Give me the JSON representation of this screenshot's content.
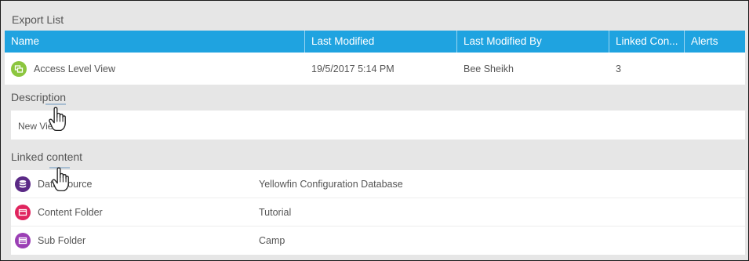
{
  "panel": {
    "title": "Export List"
  },
  "grid": {
    "columns": [
      {
        "label": "Name"
      },
      {
        "label": "Last Modified"
      },
      {
        "label": "Last Modified By"
      },
      {
        "label": "Linked Con..."
      },
      {
        "label": "Alerts"
      }
    ],
    "row": {
      "name": "Access Level View",
      "last_modified": "19/5/2017 5:14 PM",
      "last_modified_by": "Bee Sheikh",
      "linked_count": "3",
      "alerts": "",
      "icon": "view-icon",
      "icon_color": "#8cc63f"
    }
  },
  "description": {
    "header": "Description",
    "text": "New View"
  },
  "linked_content": {
    "header": "Linked content",
    "items": [
      {
        "type": "Data Source",
        "name": "Yellowfin Configuration Database",
        "icon": "database-icon",
        "color": "#5b2a86"
      },
      {
        "type": "Content Folder",
        "name": "Tutorial",
        "icon": "folder-icon",
        "color": "#e0245e"
      },
      {
        "type": "Sub Folder",
        "name": "Camp",
        "icon": "folder-icon",
        "color": "#9b3fb5"
      }
    ]
  }
}
